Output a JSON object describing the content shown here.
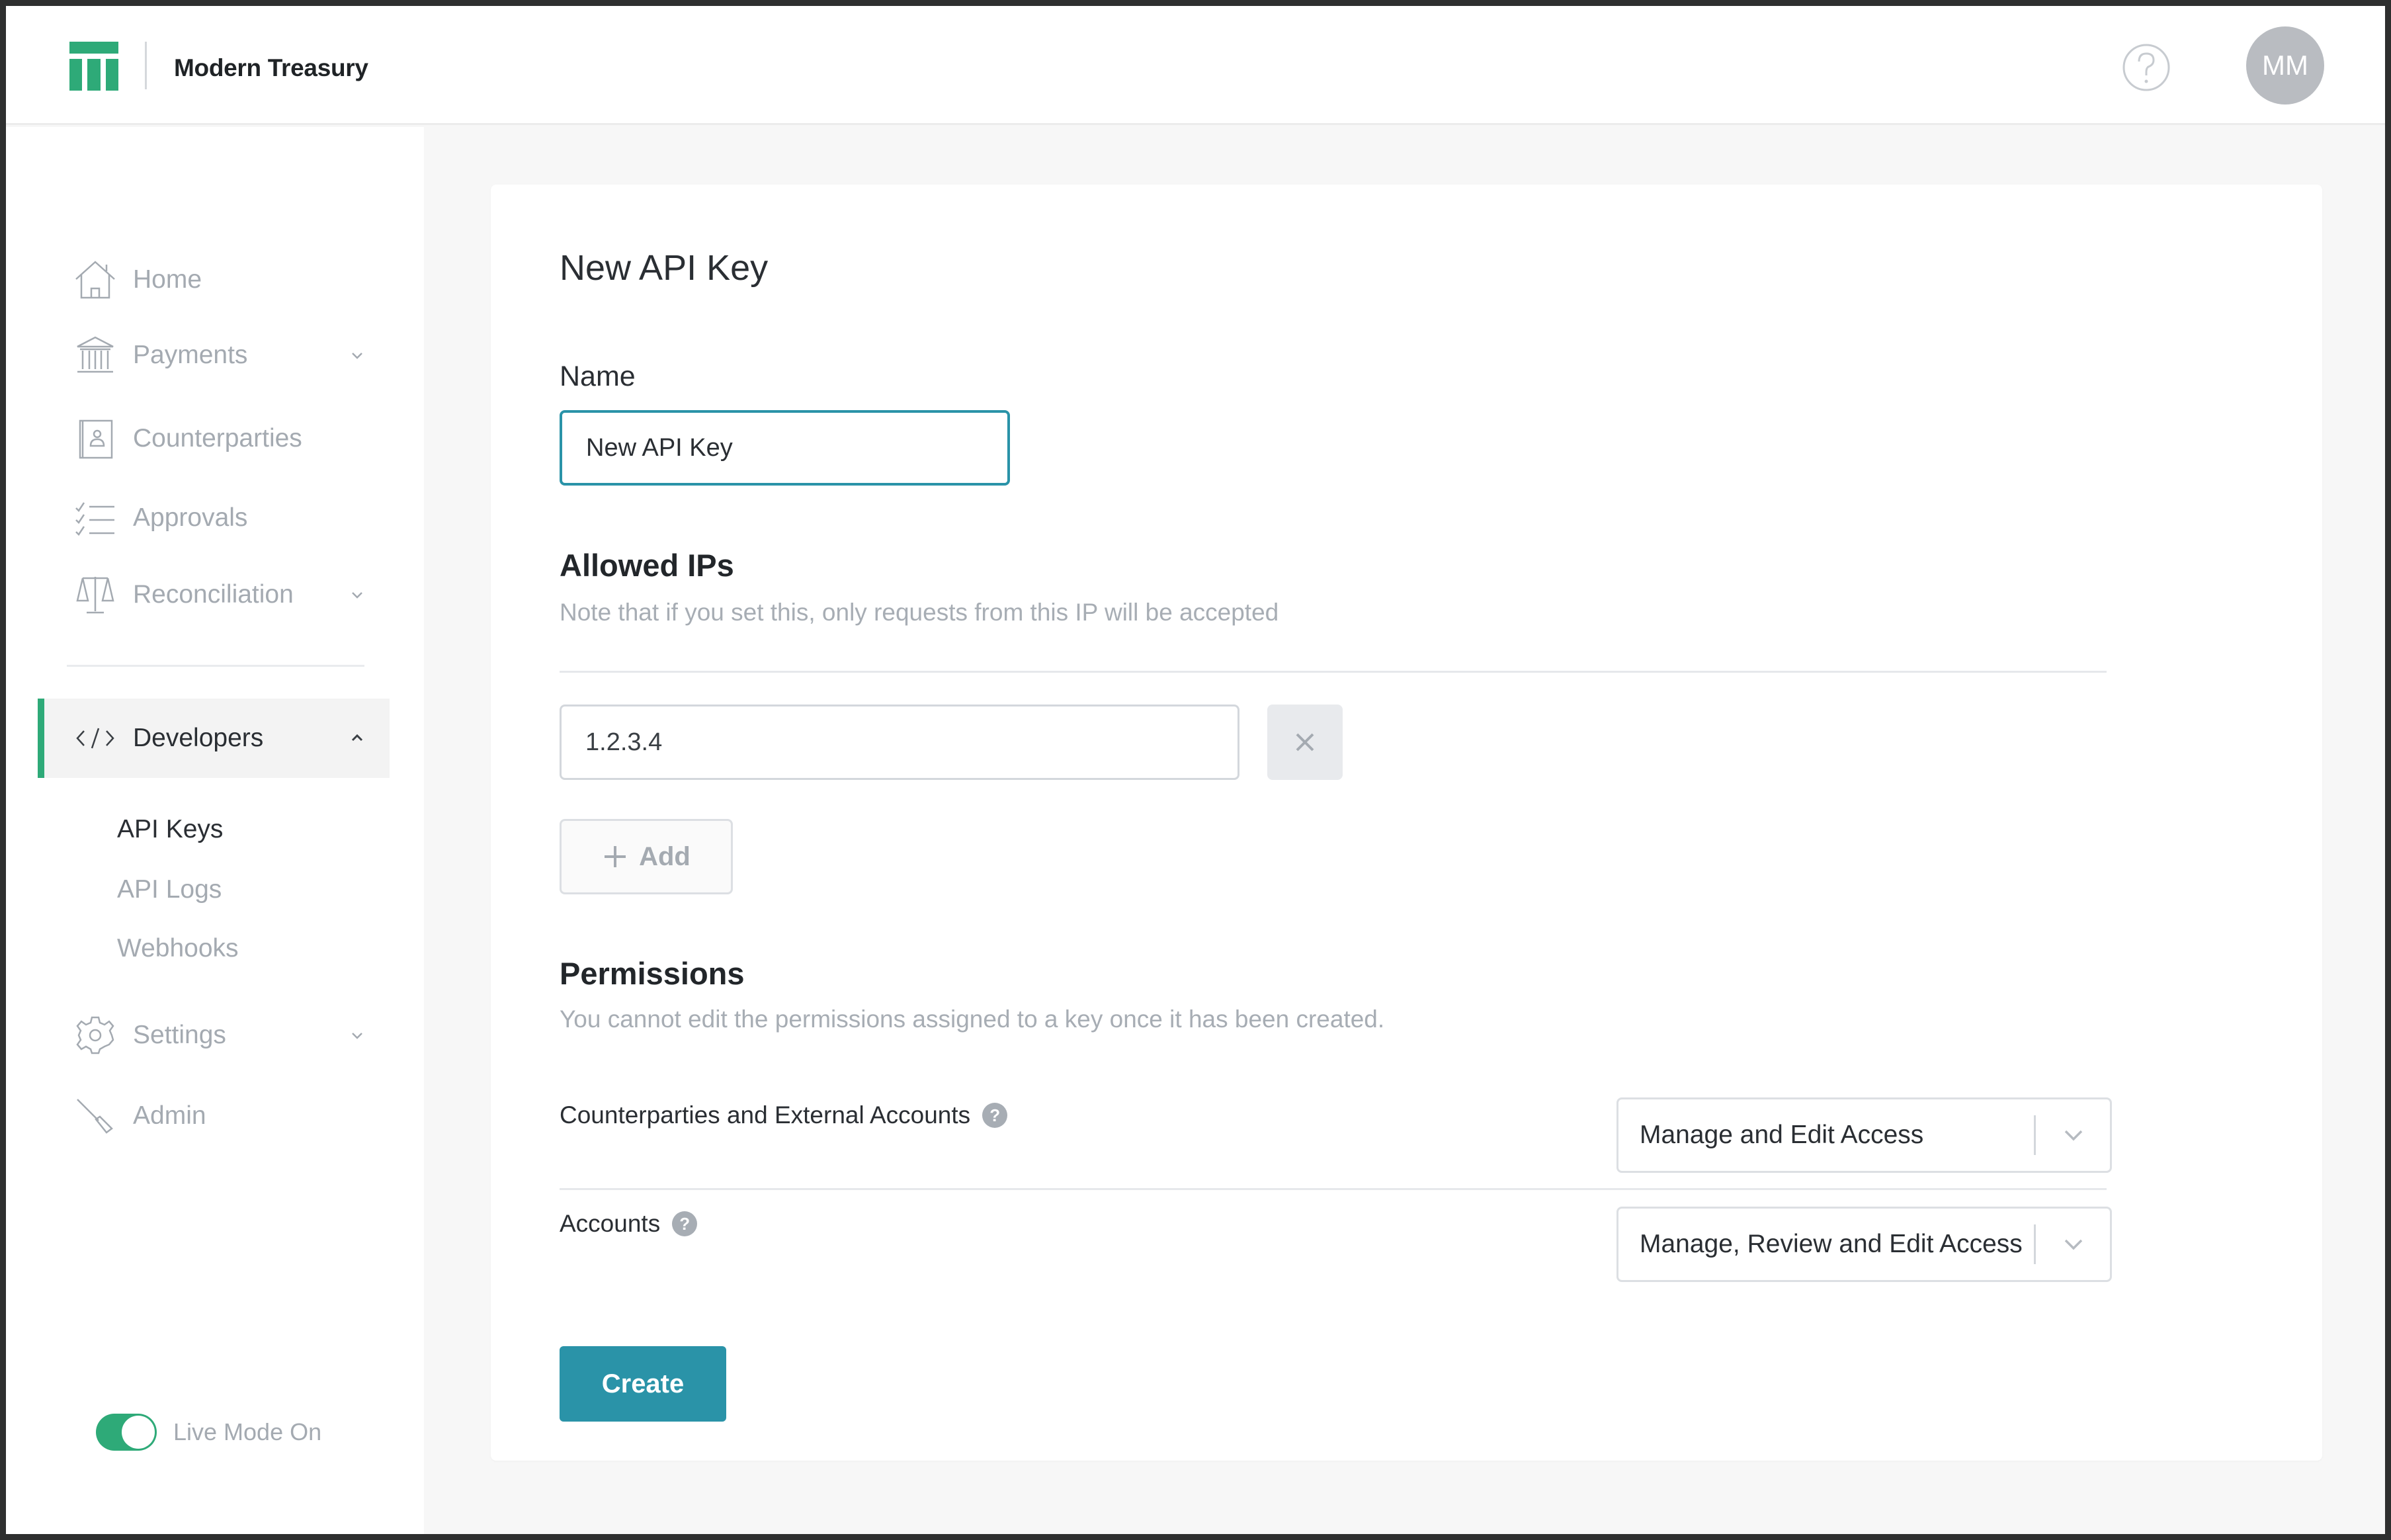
{
  "header": {
    "brand": "Modern Treasury",
    "avatar_initials": "MM",
    "colors": {
      "brand_green": "#2eaa78",
      "accent_teal": "#2a93a8"
    }
  },
  "sidebar": {
    "items": [
      {
        "label": "Home",
        "icon": "home-icon",
        "expandable": false
      },
      {
        "label": "Payments",
        "icon": "bank-icon",
        "expandable": true
      },
      {
        "label": "Counterparties",
        "icon": "contact-book-icon",
        "expandable": false
      },
      {
        "label": "Approvals",
        "icon": "checklist-icon",
        "expandable": false
      },
      {
        "label": "Reconciliation",
        "icon": "scales-icon",
        "expandable": true
      },
      {
        "label": "Developers",
        "icon": "code-icon",
        "expandable": true,
        "expanded": true,
        "active": true
      },
      {
        "label": "Settings",
        "icon": "gear-icon",
        "expandable": true
      },
      {
        "label": "Admin",
        "icon": "wrench-icon",
        "expandable": false
      }
    ],
    "developer_subitems": [
      {
        "label": "API Keys",
        "active": true
      },
      {
        "label": "API Logs",
        "active": false
      },
      {
        "label": "Webhooks",
        "active": false
      }
    ],
    "live_mode": {
      "label": "Live Mode On",
      "on": true
    }
  },
  "form": {
    "title": "New API Key",
    "name_label": "Name",
    "name_value": "New API Key",
    "allowed_ips": {
      "heading": "Allowed IPs",
      "hint": "Note that if you set this, only requests from this IP will be accepted",
      "ips": [
        "1.2.3.4"
      ],
      "add_label": "Add"
    },
    "permissions": {
      "heading": "Permissions",
      "hint": "You cannot edit the permissions assigned to a key once it has been created.",
      "rows": [
        {
          "label": "Counterparties and External Accounts",
          "value": "Manage and Edit Access"
        },
        {
          "label": "Accounts",
          "value": "Manage, Review and Edit Access"
        }
      ]
    },
    "create_label": "Create"
  }
}
